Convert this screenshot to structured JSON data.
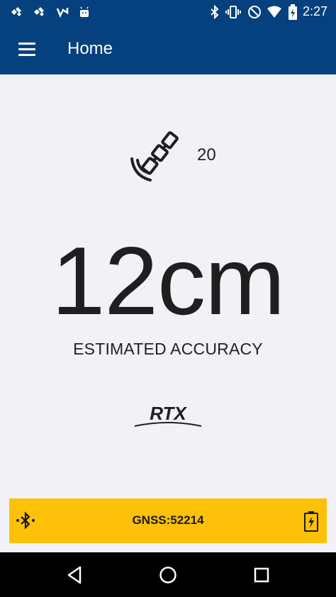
{
  "status_bar": {
    "time": "2:27",
    "icons": [
      "notification-icon",
      "notification-icon",
      "notification-icon",
      "android-icon",
      "bluetooth-icon",
      "vibrate-icon",
      "do-not-disturb-icon",
      "wifi-icon",
      "battery-charging-icon"
    ]
  },
  "app_bar": {
    "title": "Home",
    "menu_icon": "hamburger-menu-icon"
  },
  "satellite": {
    "icon": "satellite-icon",
    "count": "20"
  },
  "accuracy": {
    "value": "12cm",
    "label": "ESTIMATED ACCURACY"
  },
  "correction_logo": {
    "text": "RTX"
  },
  "gnss_bar": {
    "text": "GNSS:52214",
    "left_icon": "bluetooth-connected-icon",
    "right_icon": "battery-charging-icon"
  },
  "nav_bar": {
    "buttons": [
      "back",
      "home",
      "recents"
    ]
  },
  "colors": {
    "primary": "#05417f",
    "background": "#f2f1f6",
    "gnss_bar": "#fdc10a",
    "nav_bar": "#000000"
  }
}
